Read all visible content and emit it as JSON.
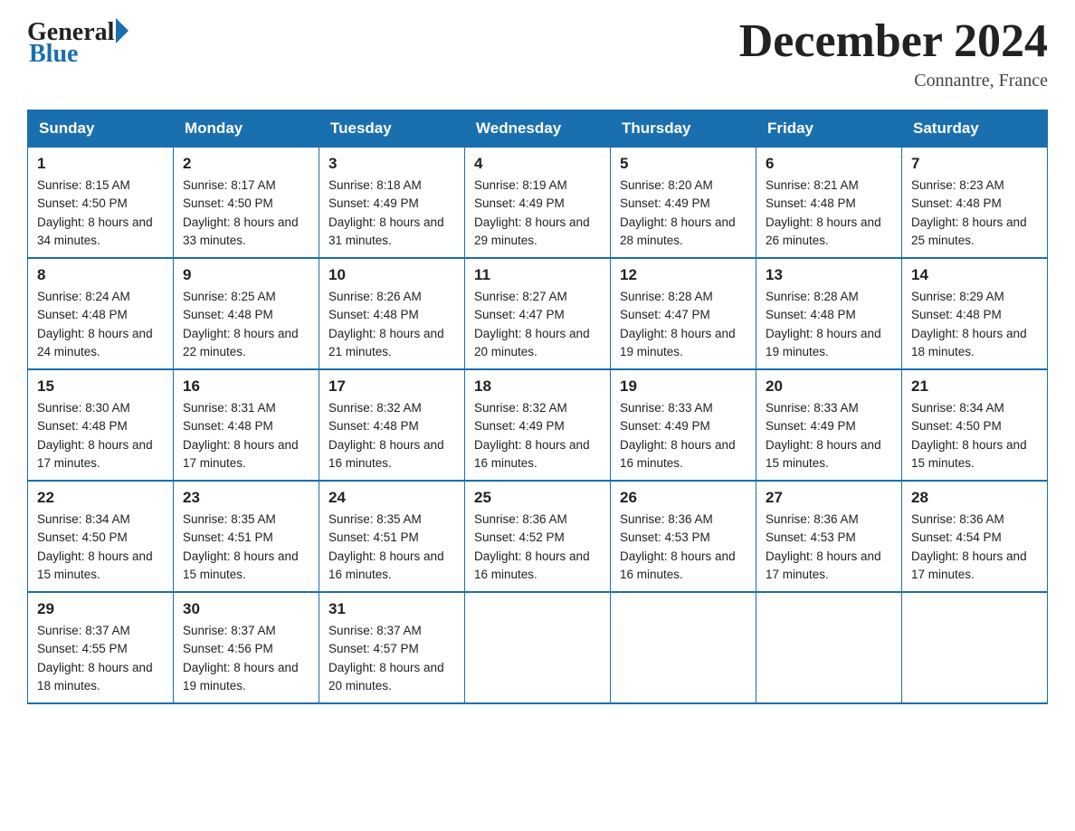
{
  "logo": {
    "general": "General",
    "blue": "Blue"
  },
  "title": "December 2024",
  "location": "Connantre, France",
  "days_header": [
    "Sunday",
    "Monday",
    "Tuesday",
    "Wednesday",
    "Thursday",
    "Friday",
    "Saturday"
  ],
  "weeks": [
    [
      {
        "num": "1",
        "sunrise": "8:15 AM",
        "sunset": "4:50 PM",
        "daylight": "8 hours and 34 minutes."
      },
      {
        "num": "2",
        "sunrise": "8:17 AM",
        "sunset": "4:50 PM",
        "daylight": "8 hours and 33 minutes."
      },
      {
        "num": "3",
        "sunrise": "8:18 AM",
        "sunset": "4:49 PM",
        "daylight": "8 hours and 31 minutes."
      },
      {
        "num": "4",
        "sunrise": "8:19 AM",
        "sunset": "4:49 PM",
        "daylight": "8 hours and 29 minutes."
      },
      {
        "num": "5",
        "sunrise": "8:20 AM",
        "sunset": "4:49 PM",
        "daylight": "8 hours and 28 minutes."
      },
      {
        "num": "6",
        "sunrise": "8:21 AM",
        "sunset": "4:48 PM",
        "daylight": "8 hours and 26 minutes."
      },
      {
        "num": "7",
        "sunrise": "8:23 AM",
        "sunset": "4:48 PM",
        "daylight": "8 hours and 25 minutes."
      }
    ],
    [
      {
        "num": "8",
        "sunrise": "8:24 AM",
        "sunset": "4:48 PM",
        "daylight": "8 hours and 24 minutes."
      },
      {
        "num": "9",
        "sunrise": "8:25 AM",
        "sunset": "4:48 PM",
        "daylight": "8 hours and 22 minutes."
      },
      {
        "num": "10",
        "sunrise": "8:26 AM",
        "sunset": "4:48 PM",
        "daylight": "8 hours and 21 minutes."
      },
      {
        "num": "11",
        "sunrise": "8:27 AM",
        "sunset": "4:47 PM",
        "daylight": "8 hours and 20 minutes."
      },
      {
        "num": "12",
        "sunrise": "8:28 AM",
        "sunset": "4:47 PM",
        "daylight": "8 hours and 19 minutes."
      },
      {
        "num": "13",
        "sunrise": "8:28 AM",
        "sunset": "4:48 PM",
        "daylight": "8 hours and 19 minutes."
      },
      {
        "num": "14",
        "sunrise": "8:29 AM",
        "sunset": "4:48 PM",
        "daylight": "8 hours and 18 minutes."
      }
    ],
    [
      {
        "num": "15",
        "sunrise": "8:30 AM",
        "sunset": "4:48 PM",
        "daylight": "8 hours and 17 minutes."
      },
      {
        "num": "16",
        "sunrise": "8:31 AM",
        "sunset": "4:48 PM",
        "daylight": "8 hours and 17 minutes."
      },
      {
        "num": "17",
        "sunrise": "8:32 AM",
        "sunset": "4:48 PM",
        "daylight": "8 hours and 16 minutes."
      },
      {
        "num": "18",
        "sunrise": "8:32 AM",
        "sunset": "4:49 PM",
        "daylight": "8 hours and 16 minutes."
      },
      {
        "num": "19",
        "sunrise": "8:33 AM",
        "sunset": "4:49 PM",
        "daylight": "8 hours and 16 minutes."
      },
      {
        "num": "20",
        "sunrise": "8:33 AM",
        "sunset": "4:49 PM",
        "daylight": "8 hours and 15 minutes."
      },
      {
        "num": "21",
        "sunrise": "8:34 AM",
        "sunset": "4:50 PM",
        "daylight": "8 hours and 15 minutes."
      }
    ],
    [
      {
        "num": "22",
        "sunrise": "8:34 AM",
        "sunset": "4:50 PM",
        "daylight": "8 hours and 15 minutes."
      },
      {
        "num": "23",
        "sunrise": "8:35 AM",
        "sunset": "4:51 PM",
        "daylight": "8 hours and 15 minutes."
      },
      {
        "num": "24",
        "sunrise": "8:35 AM",
        "sunset": "4:51 PM",
        "daylight": "8 hours and 16 minutes."
      },
      {
        "num": "25",
        "sunrise": "8:36 AM",
        "sunset": "4:52 PM",
        "daylight": "8 hours and 16 minutes."
      },
      {
        "num": "26",
        "sunrise": "8:36 AM",
        "sunset": "4:53 PM",
        "daylight": "8 hours and 16 minutes."
      },
      {
        "num": "27",
        "sunrise": "8:36 AM",
        "sunset": "4:53 PM",
        "daylight": "8 hours and 17 minutes."
      },
      {
        "num": "28",
        "sunrise": "8:36 AM",
        "sunset": "4:54 PM",
        "daylight": "8 hours and 17 minutes."
      }
    ],
    [
      {
        "num": "29",
        "sunrise": "8:37 AM",
        "sunset": "4:55 PM",
        "daylight": "8 hours and 18 minutes."
      },
      {
        "num": "30",
        "sunrise": "8:37 AM",
        "sunset": "4:56 PM",
        "daylight": "8 hours and 19 minutes."
      },
      {
        "num": "31",
        "sunrise": "8:37 AM",
        "sunset": "4:57 PM",
        "daylight": "8 hours and 20 minutes."
      },
      null,
      null,
      null,
      null
    ]
  ]
}
